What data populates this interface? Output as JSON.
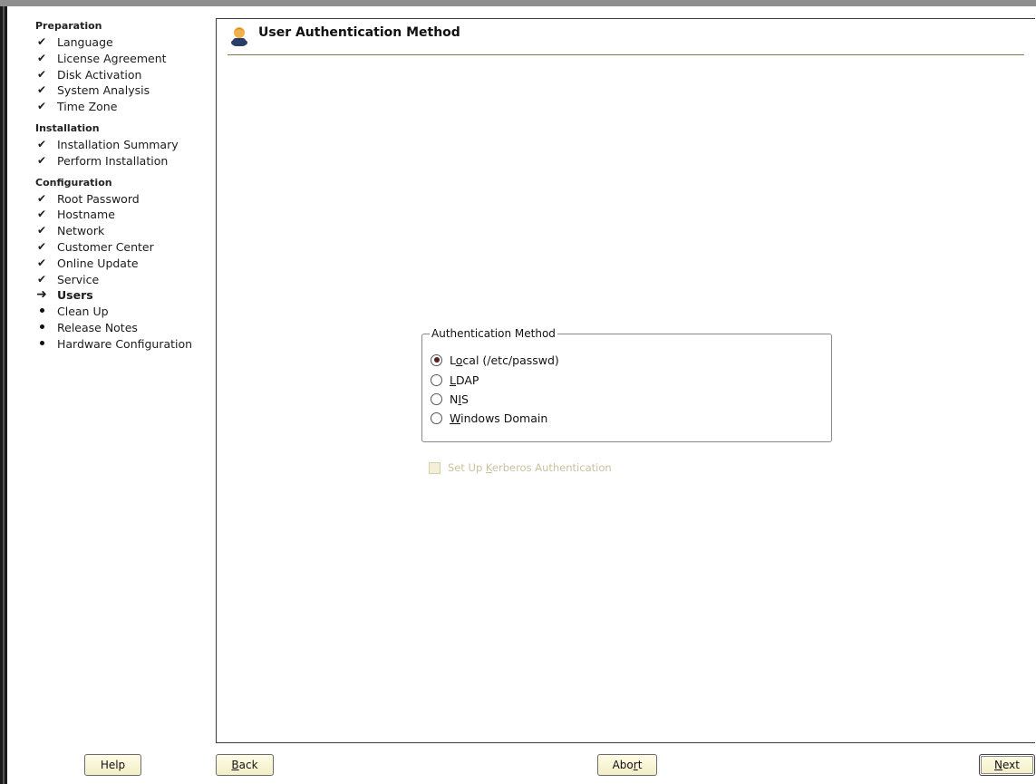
{
  "sidebar": {
    "sections": [
      {
        "title": "Preparation",
        "steps": [
          {
            "label": "Language",
            "state": "done"
          },
          {
            "label": "License Agreement",
            "state": "done"
          },
          {
            "label": "Disk Activation",
            "state": "done"
          },
          {
            "label": "System Analysis",
            "state": "done"
          },
          {
            "label": "Time Zone",
            "state": "done"
          }
        ]
      },
      {
        "title": "Installation",
        "steps": [
          {
            "label": "Installation Summary",
            "state": "done"
          },
          {
            "label": "Perform Installation",
            "state": "done"
          }
        ]
      },
      {
        "title": "Configuration",
        "steps": [
          {
            "label": "Root Password",
            "state": "done"
          },
          {
            "label": "Hostname",
            "state": "done"
          },
          {
            "label": "Network",
            "state": "done"
          },
          {
            "label": "Customer Center",
            "state": "done"
          },
          {
            "label": "Online Update",
            "state": "done"
          },
          {
            "label": "Service",
            "state": "done"
          },
          {
            "label": "Users",
            "state": "current"
          },
          {
            "label": "Clean Up",
            "state": "todo"
          },
          {
            "label": "Release Notes",
            "state": "todo"
          },
          {
            "label": "Hardware Configuration",
            "state": "todo"
          }
        ]
      }
    ]
  },
  "header": {
    "title": "User Authentication Method",
    "icon": "user-icon"
  },
  "auth_group": {
    "legend": "Authentication Method",
    "options": [
      {
        "pre": "L",
        "key": "o",
        "post": "cal (/etc/passwd)",
        "selected": true
      },
      {
        "pre": "",
        "key": "L",
        "post": "DAP",
        "selected": false
      },
      {
        "pre": "N",
        "key": "I",
        "post": "S",
        "selected": false
      },
      {
        "pre": "",
        "key": "W",
        "post": "indows Domain",
        "selected": false
      }
    ]
  },
  "kerberos": {
    "pre": "Set Up ",
    "key": "K",
    "post": "erberos Authentication",
    "checked": false,
    "enabled": false
  },
  "buttons": {
    "help": "Help",
    "back": {
      "key": "B",
      "post": "ack"
    },
    "abort": {
      "pre": "Abo",
      "key": "r",
      "post": "t"
    },
    "next": {
      "key": "N",
      "post": "ext"
    }
  },
  "colors": {
    "accent": "#5a1e1e",
    "button_bg": "#f7f3d4",
    "disabled_text": "#c9c2a0"
  }
}
